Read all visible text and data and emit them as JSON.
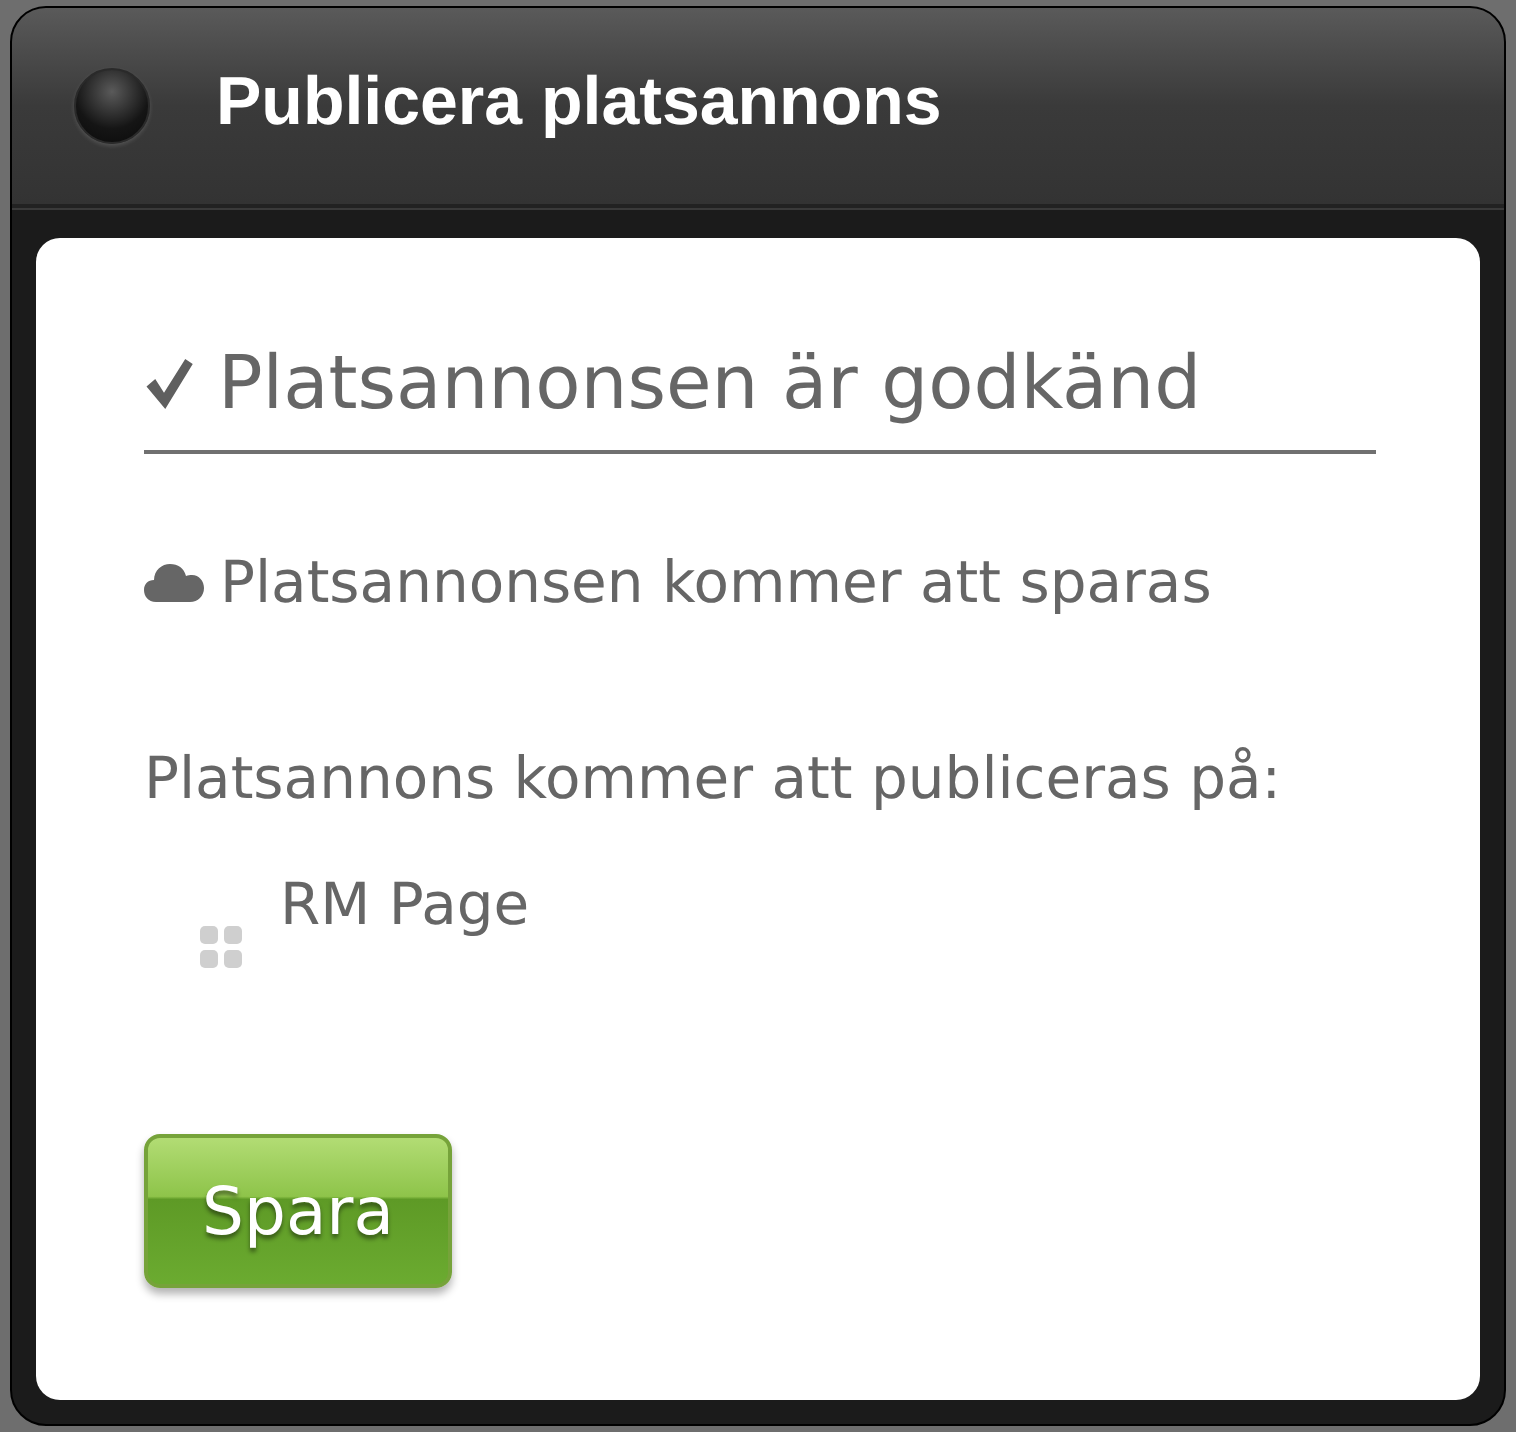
{
  "window": {
    "title": "Publicera platsannons"
  },
  "status": {
    "approved": true,
    "text": "Platsannonsen är godkänd"
  },
  "save_notice": {
    "text": "Platsannonsen kommer att sparas"
  },
  "publish": {
    "label": "Platsannons kommer att publiceras på:",
    "targets": [
      {
        "name": "RM Page"
      }
    ]
  },
  "buttons": [
    {
      "label": "Spara"
    }
  ]
}
